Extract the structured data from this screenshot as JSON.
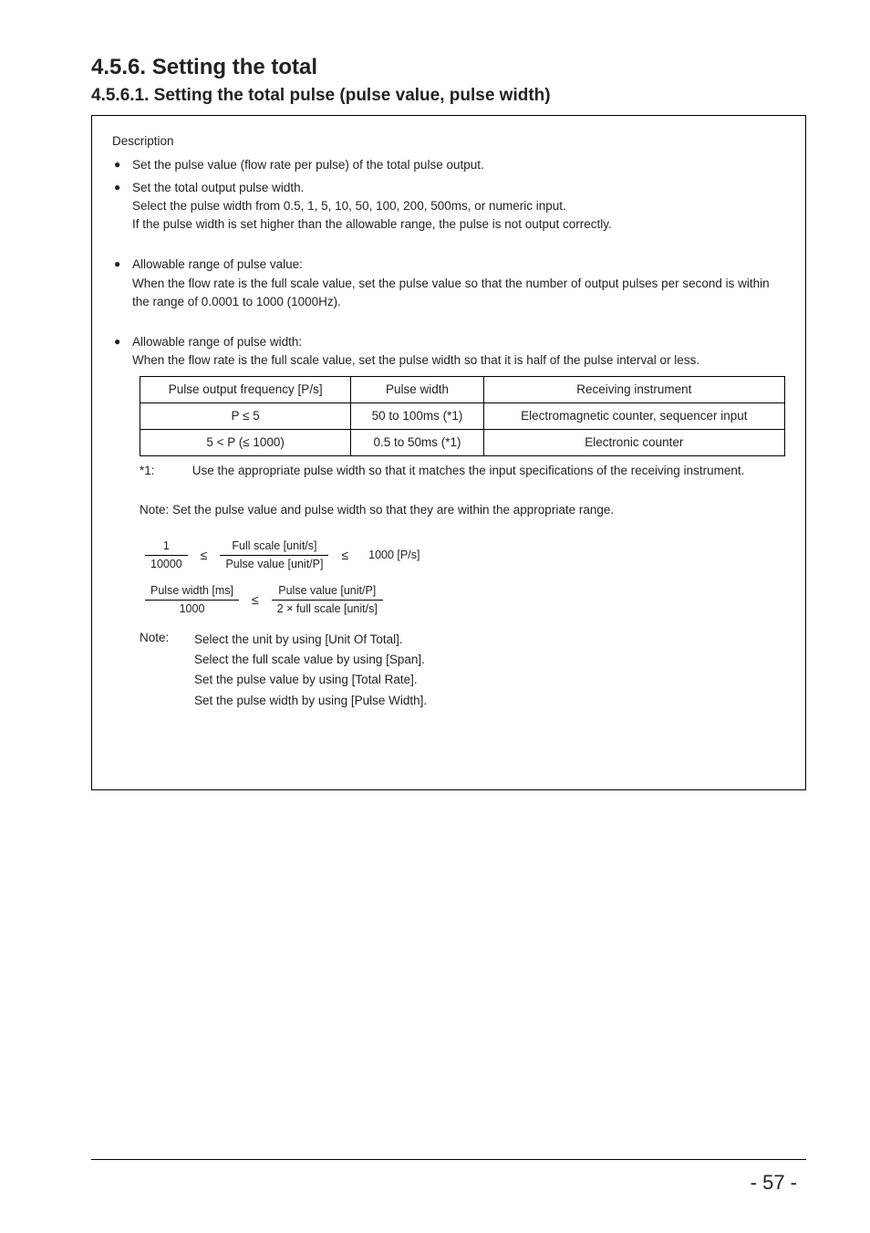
{
  "headings": {
    "h2": "4.5.6. Setting the total",
    "h3": "4.5.6.1. Setting the total pulse (pulse value, pulse width)"
  },
  "box": {
    "desc": "Description",
    "bullets": [
      {
        "main": "Set the pulse value (flow rate per pulse) of the total pulse output."
      },
      {
        "main": "Set the total output pulse width.",
        "subs": [
          "Select the pulse width from 0.5, 1, 5, 10, 50, 100, 200, 500ms, or numeric input.",
          "If the pulse width is set higher than the allowable range, the pulse is not output correctly."
        ]
      },
      {
        "main": "Allowable range of pulse value:",
        "subs": [
          "When the flow rate is the full scale value, set the pulse value so that the number of output pulses per second is within the range of 0.0001 to 1000 (1000Hz)."
        ]
      },
      {
        "main": "Allowable range of pulse width:",
        "subs": [
          "When the flow rate is the full scale value, set the pulse width so that it is half of the pulse interval or less."
        ]
      }
    ],
    "table": {
      "headers": [
        "Pulse output frequency [P/s]",
        "Pulse width",
        "Receiving instrument"
      ],
      "row1": [
        "P ≤ 5",
        "50 to 100ms (*1)",
        "Electromagnetic counter, sequencer input"
      ],
      "row2": [
        "5 < P (≤ 1000)",
        "0.5 to 50ms (*1)",
        "Electronic counter"
      ]
    },
    "tablenote_label": "*1:",
    "tablenote_body": "Use the appropriate pulse width so that it matches the input specifications of the receiving instrument.",
    "formula_intro_label": "Note:",
    "formula_intro_body": "Set the pulse value and pulse width so that they are within the appropriate range.",
    "frac1": {
      "num": "1",
      "den": "10000"
    },
    "frac2": {
      "num": "Full scale [unit/s]",
      "den": "Pulse value [unit/P]"
    },
    "range_right": "1000 [P/s]",
    "frac3": {
      "num": "Pulse width [ms]",
      "den": "1000"
    },
    "frac4": {
      "num": "Pulse value [unit/P]",
      "den": "2 × full scale [unit/s]"
    },
    "note2_label": "Note:",
    "note2_lines": [
      "Select the unit by using [Unit Of Total].",
      "Select the full scale value by using [Span].",
      "Set the pulse value by using [Total Rate].",
      "Set the pulse width by using [Pulse Width]."
    ]
  },
  "page_number": "- 57 -"
}
